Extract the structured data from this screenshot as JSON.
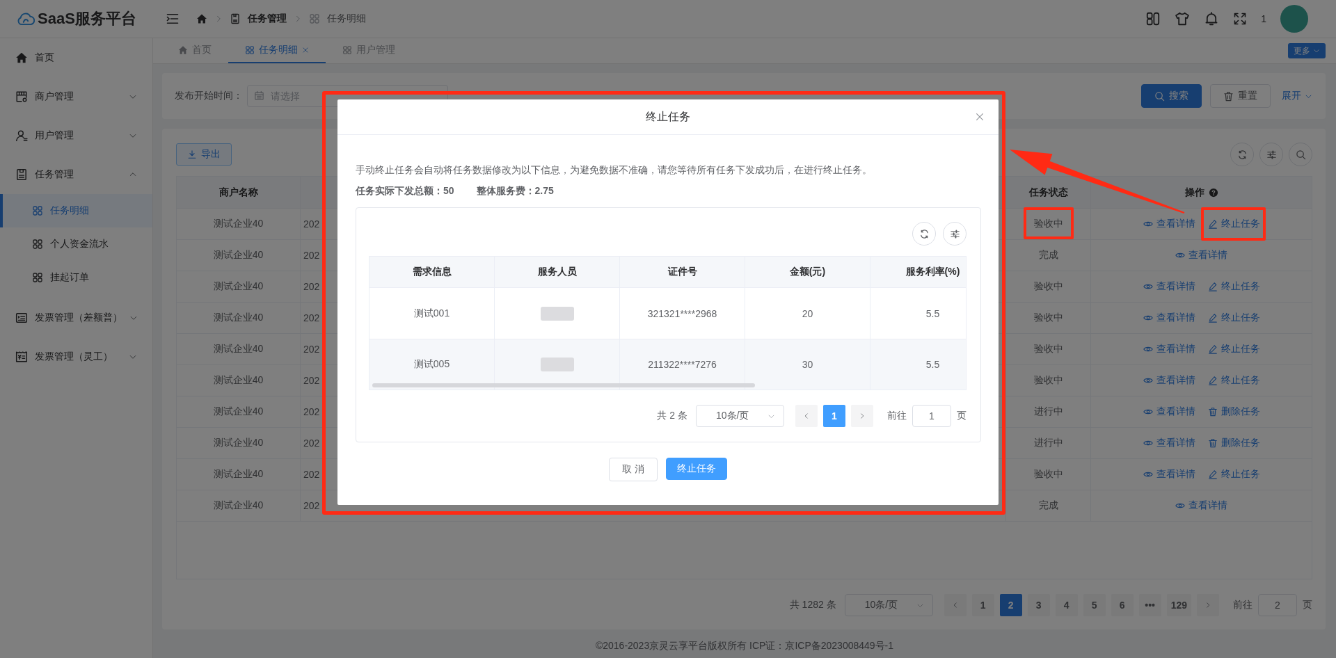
{
  "app": {
    "logo": "SaaS服务平台",
    "notice_count": "1"
  },
  "breadcrumb": [
    {
      "kind": "page",
      "label": "任务管理"
    },
    {
      "kind": "grid",
      "label": "任务明细"
    }
  ],
  "sidebar": {
    "items": [
      {
        "kind": "home",
        "label": "首页"
      },
      {
        "kind": "shop",
        "label": "商户管理",
        "expanded": false
      },
      {
        "kind": "user",
        "label": "用户管理",
        "expanded": false
      },
      {
        "kind": "task",
        "label": "任务管理",
        "expanded": true,
        "children": [
          {
            "label": "任务明细",
            "selected": true
          },
          {
            "label": "个人资金流水",
            "selected": false
          },
          {
            "label": "挂起订单",
            "selected": false
          }
        ]
      },
      {
        "kind": "invoice",
        "label": "发票管理（差额普）",
        "expanded": false
      },
      {
        "kind": "receipt",
        "label": "发票管理（灵工）",
        "expanded": false
      }
    ]
  },
  "tabs": [
    {
      "kind": "home",
      "label": "首页",
      "selected": false,
      "closable": false
    },
    {
      "kind": "grid",
      "label": "任务明细",
      "selected": true,
      "closable": true
    },
    {
      "kind": "grid",
      "label": "用户管理",
      "selected": false,
      "closable": false
    }
  ],
  "more_button": "更多",
  "filters": [
    {
      "label": "发布开始时间：",
      "placeholder": "请选择"
    }
  ],
  "filter_buttons": [
    {
      "kind": "search",
      "label": "搜索"
    },
    {
      "kind": "reset",
      "label": "重置"
    }
  ],
  "expand_link": "展开",
  "export_button": "导出",
  "table": {
    "columns": [
      {
        "label": "商户名称"
      },
      {
        "label": "任务状态"
      },
      {
        "label": "操作"
      }
    ],
    "rows": [
      {
        "merchant": "测试企业40",
        "column_2": "202",
        "status": "验收中",
        "marked": true,
        "actions": [
          {
            "kind": "view",
            "label": "查看详情"
          },
          {
            "kind": "stop",
            "label": "终止任务"
          }
        ]
      },
      {
        "merchant": "测试企业40",
        "column_2": "202",
        "status": "完成",
        "marked": false,
        "actions": [
          {
            "kind": "view",
            "label": "查看详情"
          }
        ]
      },
      {
        "merchant": "测试企业40",
        "column_2": "202",
        "status": "验收中",
        "marked": false,
        "actions": [
          {
            "kind": "view",
            "label": "查看详情"
          },
          {
            "kind": "stop",
            "label": "终止任务"
          }
        ]
      },
      {
        "merchant": "测试企业40",
        "column_2": "202",
        "status": "验收中",
        "marked": false,
        "actions": [
          {
            "kind": "view",
            "label": "查看详情"
          },
          {
            "kind": "stop",
            "label": "终止任务"
          }
        ]
      },
      {
        "merchant": "测试企业40",
        "column_2": "202",
        "status": "验收中",
        "marked": false,
        "actions": [
          {
            "kind": "view",
            "label": "查看详情"
          },
          {
            "kind": "stop",
            "label": "终止任务"
          }
        ]
      },
      {
        "merchant": "测试企业40",
        "column_2": "202",
        "status": "验收中",
        "marked": false,
        "actions": [
          {
            "kind": "view",
            "label": "查看详情"
          },
          {
            "kind": "stop",
            "label": "终止任务"
          }
        ]
      },
      {
        "merchant": "测试企业40",
        "column_2": "202",
        "status": "进行中",
        "marked": false,
        "actions": [
          {
            "kind": "view",
            "label": "查看详情"
          },
          {
            "kind": "delete",
            "label": "删除任务"
          }
        ]
      },
      {
        "merchant": "测试企业40",
        "column_2": "202",
        "status": "进行中",
        "marked": false,
        "actions": [
          {
            "kind": "view",
            "label": "查看详情"
          },
          {
            "kind": "delete",
            "label": "删除任务"
          }
        ]
      },
      {
        "merchant": "测试企业40",
        "column_2": "202",
        "status": "验收中",
        "marked": false,
        "actions": [
          {
            "kind": "view",
            "label": "查看详情"
          },
          {
            "kind": "stop",
            "label": "终止任务"
          }
        ]
      },
      {
        "merchant": "测试企业40",
        "column_2": "202",
        "status": "完成",
        "marked": false,
        "actions": [
          {
            "kind": "view",
            "label": "查看详情"
          }
        ]
      }
    ]
  },
  "pagination": {
    "total": "共 1282 条",
    "page_size": "10条/页",
    "pages": [
      {
        "label": "1",
        "selected": false
      },
      {
        "label": "2",
        "selected": true
      },
      {
        "label": "3",
        "selected": false
      },
      {
        "label": "4",
        "selected": false
      },
      {
        "label": "5",
        "selected": false
      },
      {
        "label": "6",
        "selected": false
      },
      {
        "label": "•••",
        "selected": false
      },
      {
        "label": "129",
        "selected": false
      }
    ],
    "goto_label": "前往",
    "goto_value": "2",
    "goto_unit": "页"
  },
  "footer": "©2016-2023京灵云享平台版权所有 ICP证：京ICP备2023008449号-1",
  "dialog": {
    "title": "终止任务",
    "marked": true,
    "notice": "手动终止任务会自动将任务数据修改为以下信息，为避免数据不准确，请您等待所有任务下发成功后，在进行终止任务。",
    "summary": [
      "任务实际下发总额：50",
      "整体服务费：2.75"
    ],
    "columns": [
      "需求信息",
      "服务人员",
      "证件号",
      "金额(元)",
      "服务利率(%)"
    ],
    "rows": [
      {
        "cells": [
          {
            "kind": "text",
            "text": "测试001"
          },
          {
            "kind": "blurred"
          },
          {
            "kind": "text",
            "text": "321321****2968"
          },
          {
            "kind": "text",
            "text": "20"
          },
          {
            "kind": "text",
            "text": "5.5"
          }
        ]
      },
      {
        "cells": [
          {
            "kind": "text",
            "text": "测试005"
          },
          {
            "kind": "blurred"
          },
          {
            "kind": "text",
            "text": "211322****7276"
          },
          {
            "kind": "text",
            "text": "30"
          },
          {
            "kind": "text",
            "text": "5.5"
          }
        ]
      }
    ],
    "pagination": {
      "total": "共 2 条",
      "page_size": "10条/页",
      "pages": [
        {
          "label": "1",
          "selected": true
        }
      ],
      "goto_label": "前往",
      "goto_value": "1",
      "goto_unit": "页"
    },
    "buttons": [
      {
        "kind": "cancel",
        "label": "取 消"
      },
      {
        "kind": "confirm",
        "label": "终止任务"
      }
    ]
  }
}
